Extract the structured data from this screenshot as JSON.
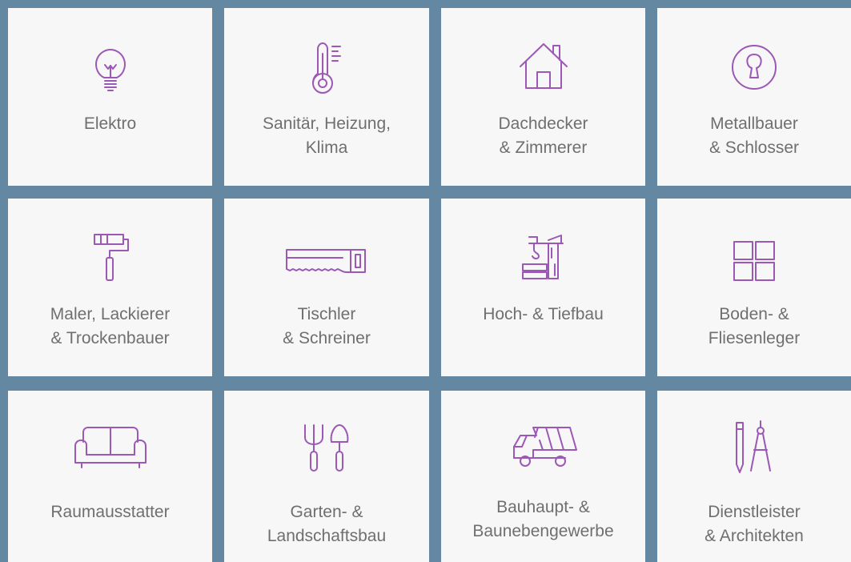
{
  "colors": {
    "background": "#6487a2",
    "tile": "#f7f7f7",
    "icon": "#9b58b5",
    "text": "#6f6f6f"
  },
  "tiles": [
    {
      "label": "Elektro",
      "icon": "lightbulb-icon"
    },
    {
      "label": "Sanitär, Heizung,\nKlima",
      "icon": "thermometer-icon"
    },
    {
      "label": "Dachdecker\n& Zimmerer",
      "icon": "house-icon"
    },
    {
      "label": "Metallbauer\n& Schlosser",
      "icon": "keyhole-icon"
    },
    {
      "label": "Maler, Lackierer\n& Trockenbauer",
      "icon": "paint-roller-icon"
    },
    {
      "label": "Tischler\n& Schreiner",
      "icon": "saw-icon"
    },
    {
      "label": "Hoch- & Tiefbau",
      "icon": "crane-icon"
    },
    {
      "label": "Boden- &\nFliesenleger",
      "icon": "tiles-icon"
    },
    {
      "label": "Raumausstatter",
      "icon": "sofa-icon"
    },
    {
      "label": "Garten- &\nLandschaftsbau",
      "icon": "garden-tools-icon"
    },
    {
      "label": "Bauhaupt- &\nBaunebengewerbe",
      "icon": "dump-truck-icon"
    },
    {
      "label": "Dienstleister\n& Architekten",
      "icon": "pencil-compass-icon"
    }
  ]
}
